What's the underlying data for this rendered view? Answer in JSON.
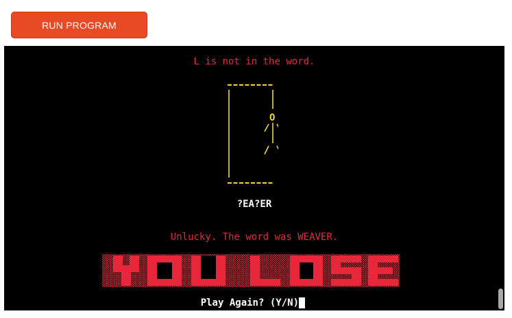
{
  "toolbar": {
    "run_label": "RUN PROGRAM",
    "run_color": "#e84a26"
  },
  "terminal": {
    "message": "L is not in the word.",
    "word_progress": "?EA?ER",
    "result": "Unlucky. The word was WEAVER.",
    "banner_text": "YOU LOSE",
    "prompt": "Play Again? (Y/N)",
    "colors": {
      "error": "#e8283a",
      "gallows": "#f5d23c",
      "text": "#ffffff",
      "background": "#000000"
    }
  }
}
